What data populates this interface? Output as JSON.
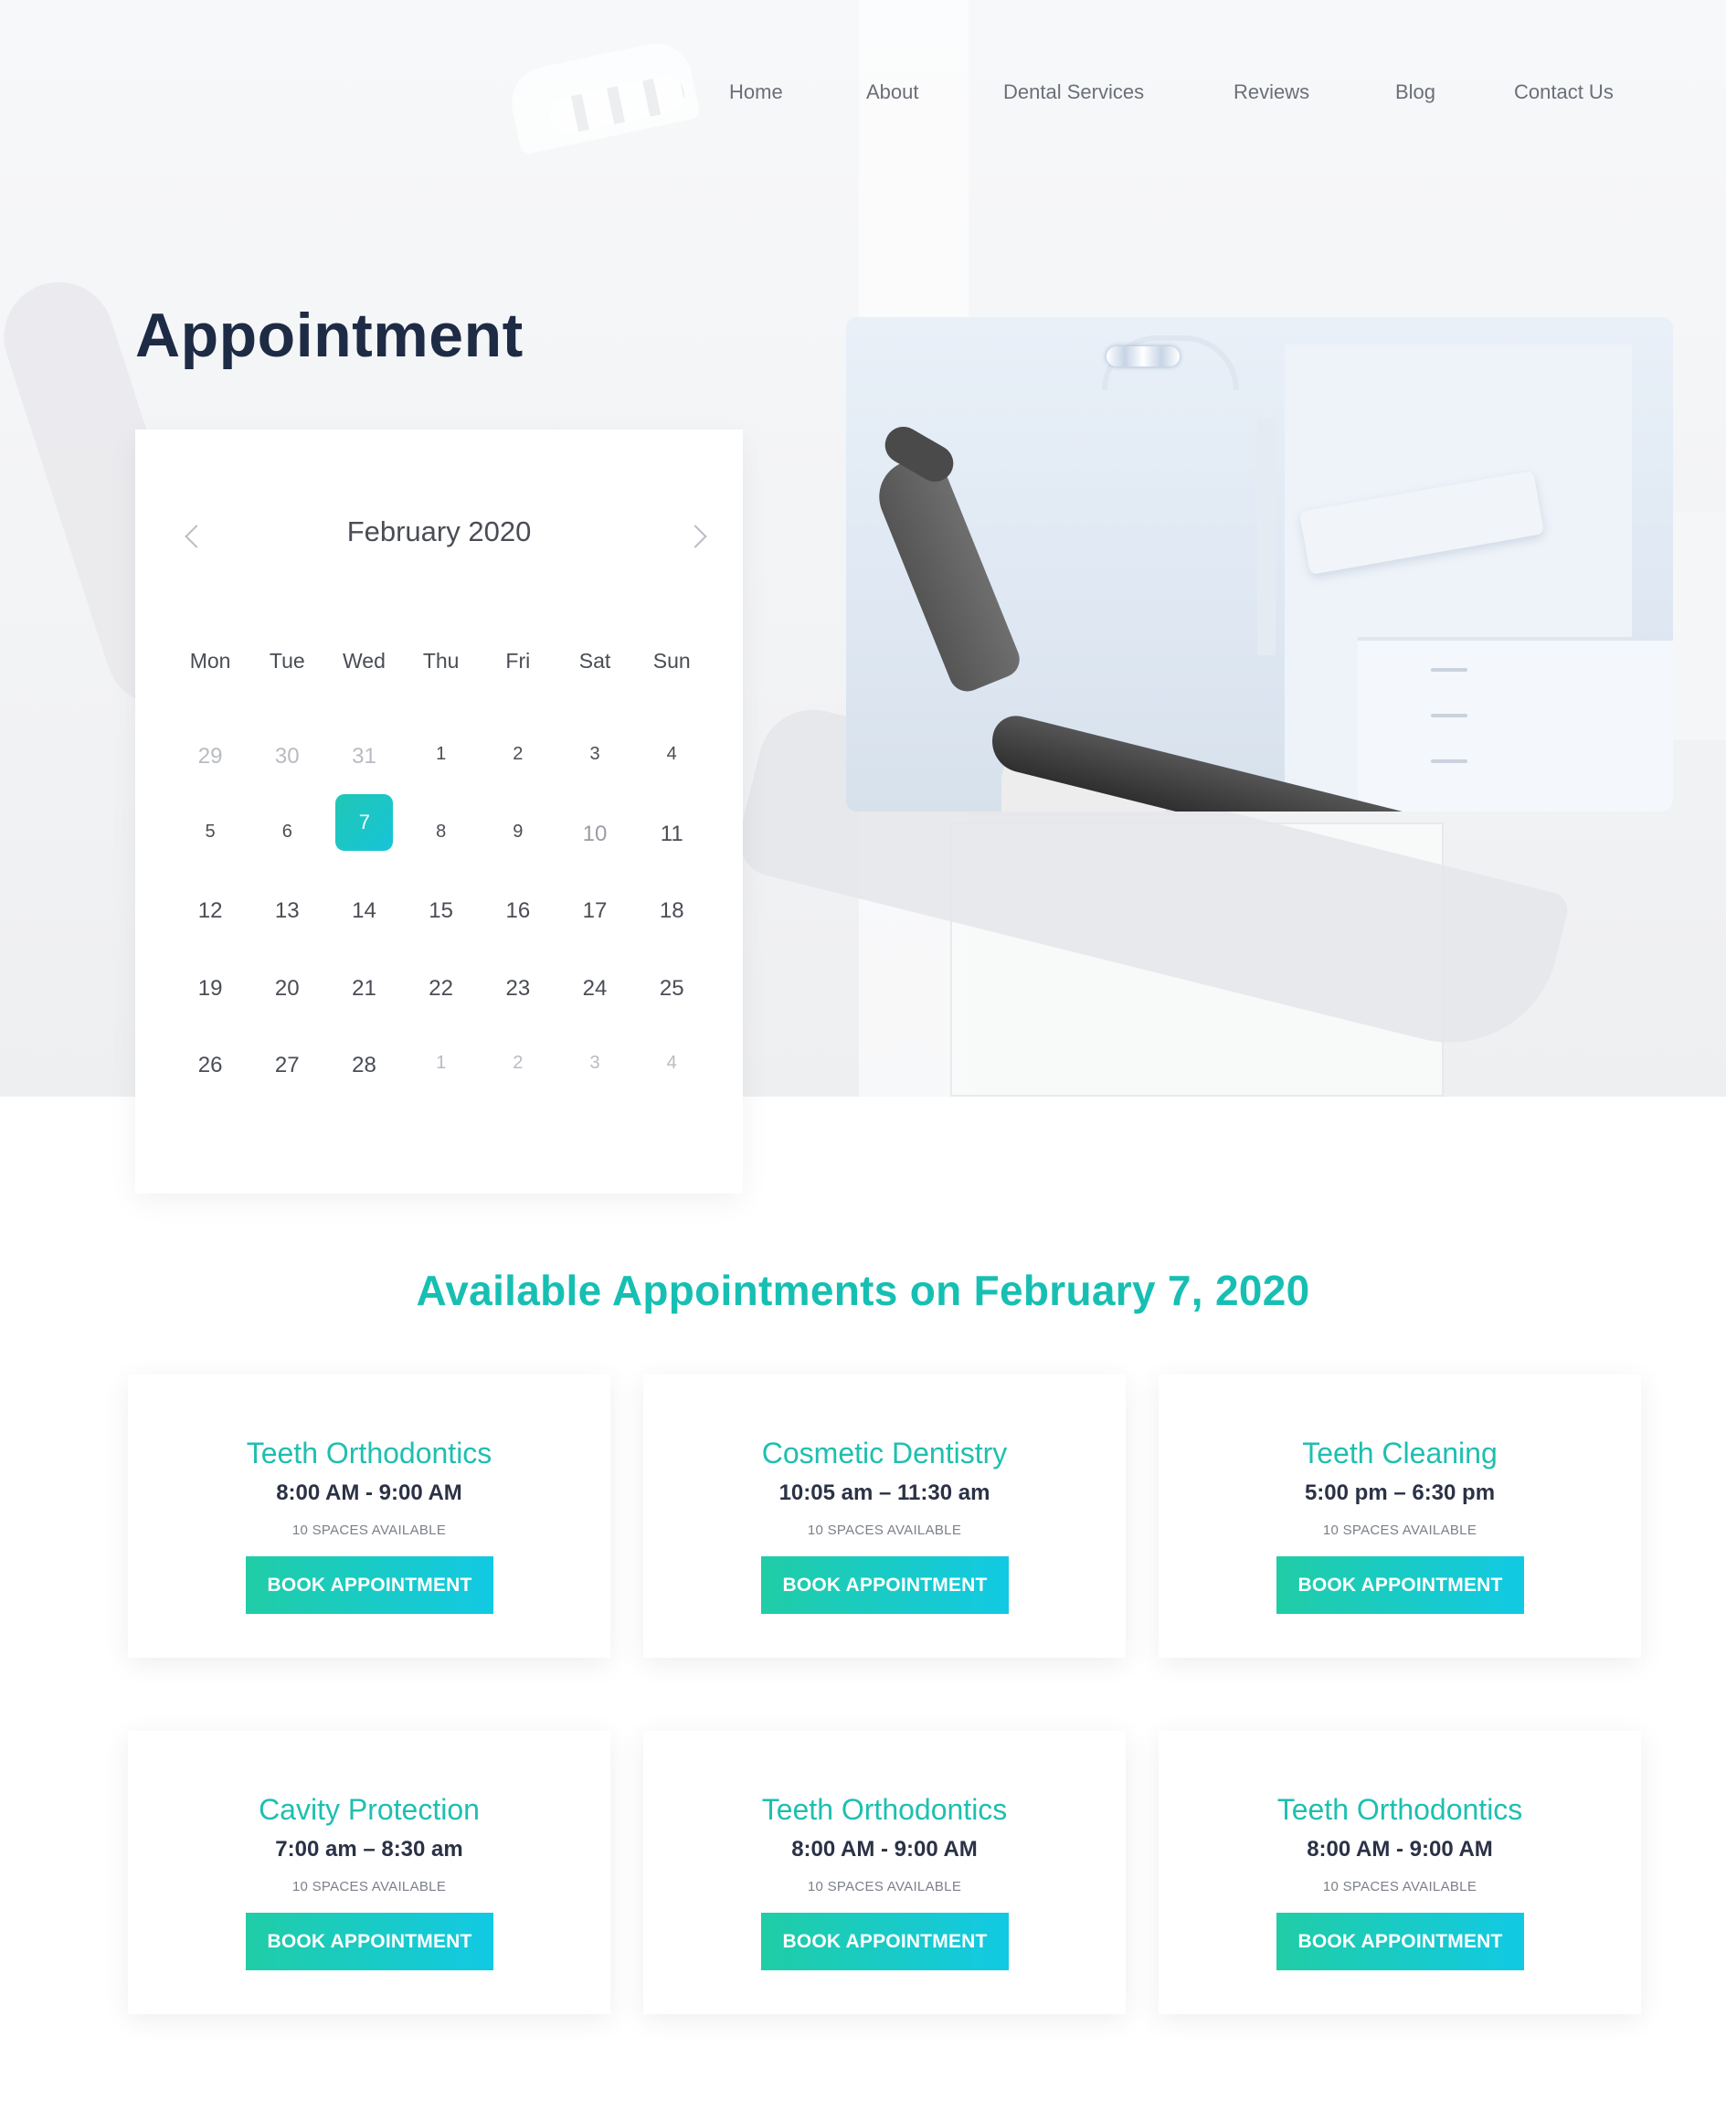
{
  "nav": {
    "items": [
      "Home",
      "About",
      "Dental Services",
      "Reviews",
      "Blog",
      "Contact Us"
    ]
  },
  "hero": {
    "title": "Appointment"
  },
  "calendar": {
    "month_label": "February 2020",
    "weekdays": [
      "Mon",
      "Tue",
      "Wed",
      "Thu",
      "Fri",
      "Sat",
      "Sun"
    ],
    "weeks": [
      [
        "29",
        "30",
        "31",
        "1",
        "2",
        "3",
        "4"
      ],
      [
        "5",
        "6",
        "7",
        "8",
        "9",
        "10",
        "11"
      ],
      [
        "12",
        "13",
        "14",
        "15",
        "16",
        "17",
        "18"
      ],
      [
        "19",
        "20",
        "21",
        "22",
        "23",
        "24",
        "25"
      ],
      [
        "26",
        "27",
        "28",
        "1",
        "2",
        "3",
        "4"
      ]
    ],
    "selected_day": "7"
  },
  "available": {
    "title": "Available Appointments on February 7, 2020",
    "cards": [
      {
        "service": "Teeth Orthodontics",
        "time": "8:00 AM - 9:00 AM",
        "spaces": "10 SPACES AVAILABLE",
        "button": "BOOK APPOINTMENT"
      },
      {
        "service": "Cosmetic Dentistry",
        "time": "10:05 am – 11:30 am",
        "spaces": "10 SPACES AVAILABLE",
        "button": "BOOK APPOINTMENT"
      },
      {
        "service": "Teeth Cleaning",
        "time": "5:00 pm – 6:30 pm",
        "spaces": "10 SPACES AVAILABLE",
        "button": "BOOK APPOINTMENT"
      },
      {
        "service": "Cavity Protection",
        "time": "7:00 am – 8:30 am",
        "spaces": "10 SPACES AVAILABLE",
        "button": "BOOK APPOINTMENT"
      },
      {
        "service": "Teeth Orthodontics",
        "time": "8:00 AM - 9:00 AM",
        "spaces": "10 SPACES AVAILABLE",
        "button": "BOOK APPOINTMENT"
      },
      {
        "service": "Teeth Orthodontics",
        "time": "8:00 AM - 9:00 AM",
        "spaces": "10 SPACES AVAILABLE",
        "button": "BOOK APPOINTMENT"
      }
    ]
  },
  "colors": {
    "accent": "#17bfb3",
    "button_gradient_start": "#20cda6",
    "button_gradient_end": "#12c9e4",
    "heading_dark": "#1e2b45"
  },
  "icons": {
    "calendar_prev": "chevron-left-icon",
    "calendar_next": "chevron-right-icon"
  }
}
